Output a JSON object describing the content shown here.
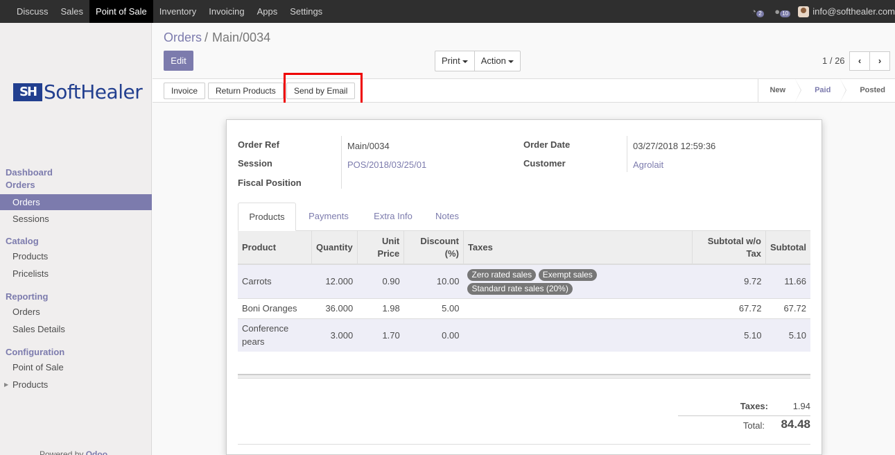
{
  "topbar": {
    "menu": [
      "Discuss",
      "Sales",
      "Point of Sale",
      "Inventory",
      "Invoicing",
      "Apps",
      "Settings"
    ],
    "active_index": 2,
    "activity_count": "2",
    "message_count": "10",
    "user": "info@softhealer.com"
  },
  "logo": {
    "mark": "SH",
    "word": "SoftHealer"
  },
  "sidebar": {
    "dashboard": "Dashboard",
    "orders_head": "Orders",
    "orders_items": [
      "Orders",
      "Sessions"
    ],
    "catalog": "Catalog",
    "catalog_items": [
      "Products",
      "Pricelists"
    ],
    "reporting": "Reporting",
    "reporting_items": [
      "Orders",
      "Sales Details"
    ],
    "configuration": "Configuration",
    "configuration_items": [
      "Point of Sale",
      "Products"
    ],
    "powered_prefix": "Powered by ",
    "powered_brand": "Odoo"
  },
  "breadcrumb": {
    "parent": "Orders",
    "separator": "/",
    "current": "Main/0034"
  },
  "buttons": {
    "edit": "Edit",
    "print": "Print",
    "action": "Action",
    "invoice": "Invoice",
    "return_products": "Return Products",
    "send_by_email": "Send by Email"
  },
  "pager": {
    "value": "1 / 26",
    "prev": "‹",
    "next": "›"
  },
  "stages": [
    "New",
    "Paid",
    "Posted"
  ],
  "active_stage": "Paid",
  "form": {
    "order_ref_label": "Order Ref",
    "order_ref": "Main/0034",
    "session_label": "Session",
    "session": "POS/2018/03/25/01",
    "fiscal_position_label": "Fiscal Position",
    "order_date_label": "Order Date",
    "order_date": "03/27/2018 12:59:36",
    "customer_label": "Customer",
    "customer": "Agrolait"
  },
  "tabs": [
    "Products",
    "Payments",
    "Extra Info",
    "Notes"
  ],
  "table": {
    "headers": {
      "product": "Product",
      "quantity": "Quantity",
      "unit_price_1": "Unit",
      "unit_price_2": "Price",
      "discount_1": "Discount",
      "discount_2": "(%)",
      "taxes": "Taxes",
      "subtotal_wo_tax_1": "Subtotal w/o",
      "subtotal_wo_tax_2": "Tax",
      "subtotal": "Subtotal"
    },
    "rows": [
      {
        "product_1": "Carrots",
        "product_2": "",
        "quantity": "12.000",
        "unit_price": "0.90",
        "discount": "10.00",
        "taxes": [
          "Zero rated sales",
          "Exempt sales",
          "Standard rate sales (20%)"
        ],
        "subtotal_wo_tax": "9.72",
        "subtotal": "11.66"
      },
      {
        "product_1": "Boni Oranges",
        "product_2": "",
        "quantity": "36.000",
        "unit_price": "1.98",
        "discount": "5.00",
        "taxes": [],
        "subtotal_wo_tax": "67.72",
        "subtotal": "67.72"
      },
      {
        "product_1": "Conference",
        "product_2": "pears",
        "quantity": "3.000",
        "unit_price": "1.70",
        "discount": "0.00",
        "taxes": [],
        "subtotal_wo_tax": "5.10",
        "subtotal": "5.10"
      }
    ]
  },
  "totals": {
    "taxes_label": "Taxes:",
    "taxes": "1.94",
    "total_label": "Total:",
    "total": "84.48"
  },
  "colors": {
    "accent": "#7c7bad",
    "navbar": "#2f2f2f",
    "highlight": "#ee0000"
  }
}
